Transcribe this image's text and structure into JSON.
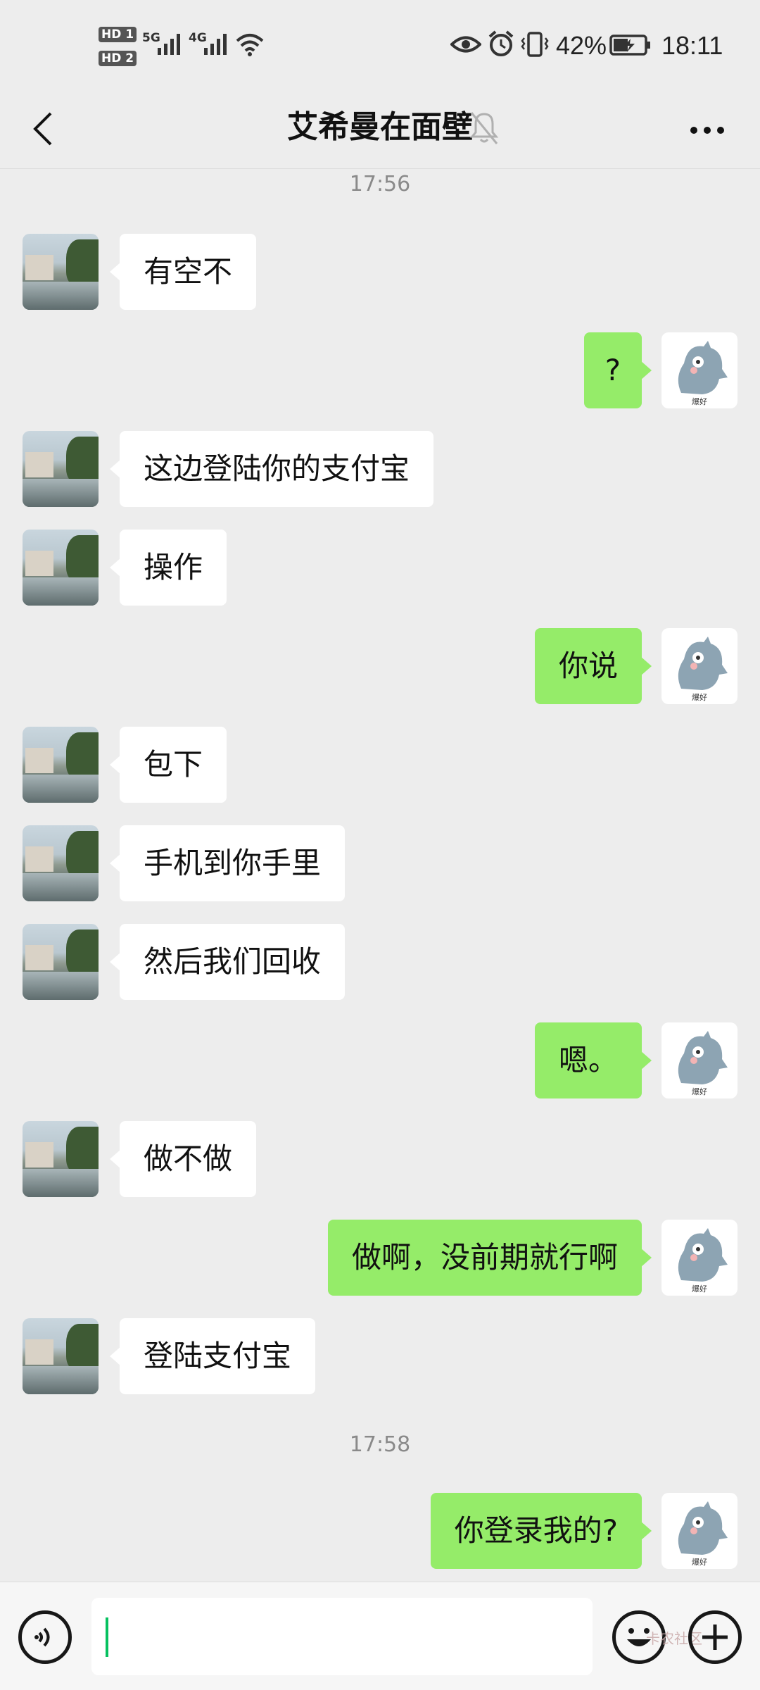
{
  "status_bar": {
    "sim1_label": "HD 1",
    "sim2_label": "HD 2",
    "net1": "5G",
    "net2": "4G",
    "battery_percent": "42%",
    "time": "18:11"
  },
  "header": {
    "title": "艾希曼在面壁",
    "muted": true
  },
  "messages": [
    {
      "type": "time",
      "text": "17:56"
    },
    {
      "type": "in",
      "text": "有空不"
    },
    {
      "type": "out",
      "text": "?"
    },
    {
      "type": "in",
      "text": "这边登陆你的支付宝"
    },
    {
      "type": "in",
      "text": "操作"
    },
    {
      "type": "out",
      "text": "你说"
    },
    {
      "type": "in",
      "text": "包下"
    },
    {
      "type": "in",
      "text": "手机到你手里"
    },
    {
      "type": "in",
      "text": "然后我们回收"
    },
    {
      "type": "out",
      "text": "嗯。"
    },
    {
      "type": "in",
      "text": "做不做"
    },
    {
      "type": "out",
      "text": "做啊，没前期就行啊"
    },
    {
      "type": "in",
      "text": "登陆支付宝"
    },
    {
      "type": "time",
      "text": "17:58"
    },
    {
      "type": "out",
      "text": "你登录我的?"
    }
  ],
  "sticker_caption": "爆好",
  "input": {
    "value": "",
    "watermark": "卡农社区"
  },
  "colors": {
    "background": "#ededed",
    "bubble_in": "#ffffff",
    "bubble_out": "#95ec69",
    "caret": "#07c160"
  }
}
